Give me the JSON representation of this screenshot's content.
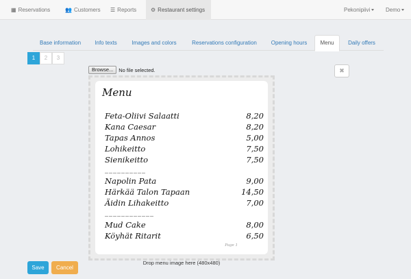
{
  "nav": {
    "items": [
      {
        "label": "Reservations",
        "icon": "calendar-icon"
      },
      {
        "label": "Customers",
        "icon": "users-icon"
      },
      {
        "label": "Reports",
        "icon": "list-icon"
      },
      {
        "label": "Restaurant settings",
        "icon": "gear-icon"
      }
    ],
    "right": [
      {
        "label": "Pekonipiivi"
      },
      {
        "label": "Demo"
      }
    ]
  },
  "tabs": [
    {
      "label": "Base information"
    },
    {
      "label": "Info texts"
    },
    {
      "label": "Images and colors"
    },
    {
      "label": "Reservations configuration"
    },
    {
      "label": "Opening hours"
    },
    {
      "label": "Menu"
    },
    {
      "label": "Daily offers"
    }
  ],
  "pager": [
    "1",
    "2",
    "3"
  ],
  "upload": {
    "browse_label": "Browse...",
    "status": "No file selected.",
    "remove_label": "✖",
    "drop_hint": "Drop menu image here (480x480)"
  },
  "menu_image": {
    "heading": "Menu",
    "items": [
      {
        "name": "Feta-Oliivi Salaatti",
        "price": "8,20"
      },
      {
        "name": "Kana Caesar",
        "price": "8,20"
      },
      {
        "name": "Tapas Annos",
        "price": "5,00"
      },
      {
        "name": "Lohikeitto",
        "price": "7,50"
      },
      {
        "name": "Sienikeitto",
        "price": "7,50"
      },
      {
        "name": "Napolin Pata",
        "price": "9,00"
      },
      {
        "name": "Härkää Talon Tapaan",
        "price": "14,50"
      },
      {
        "name": "Äidin Lihakeitto",
        "price": "7,00"
      },
      {
        "name": "Mud Cake",
        "price": "8,00"
      },
      {
        "name": "Köyhät Ritarit",
        "price": "6,50"
      }
    ],
    "separators": [
      "__________",
      "____________"
    ],
    "footer": "Page 1"
  },
  "actions": {
    "save_label": "Save",
    "cancel_label": "Cancel"
  },
  "colors": {
    "primary": "#2ea5d9",
    "warning": "#f0ad4e",
    "link": "#337ab7"
  }
}
